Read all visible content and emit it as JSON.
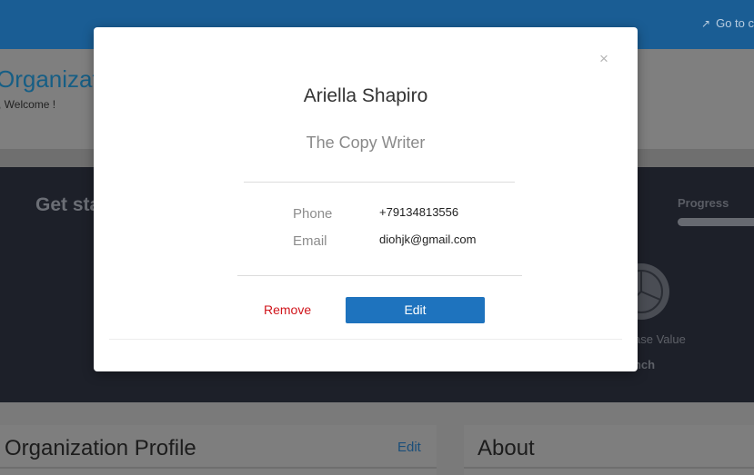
{
  "header": {
    "goto_label": "Go to c",
    "goto_icon": "share-icon"
  },
  "hero": {
    "title": "Organizati",
    "welcome": ", Welcome !"
  },
  "dashboard": {
    "get_started": "Get sta",
    "progress_label": "Progress",
    "progress_value": 1.0,
    "base_value": "ase Value",
    "launch": "unch"
  },
  "cards": {
    "organization_profile": {
      "title": "Organization Profile",
      "edit_label": "Edit"
    },
    "about": {
      "title": "About"
    }
  },
  "modal": {
    "close_glyph": "×",
    "name": "Ariella Shapiro",
    "role": "The Copy Writer",
    "phone_label": "Phone",
    "phone_value": "+79134813556",
    "email_label": "Email",
    "email_value": "diohjk@gmail.com",
    "remove_label": "Remove",
    "edit_label": "Edit"
  },
  "colors": {
    "primary": "#1e73be",
    "danger": "#d0151b",
    "topbar": "#1a5d94"
  }
}
